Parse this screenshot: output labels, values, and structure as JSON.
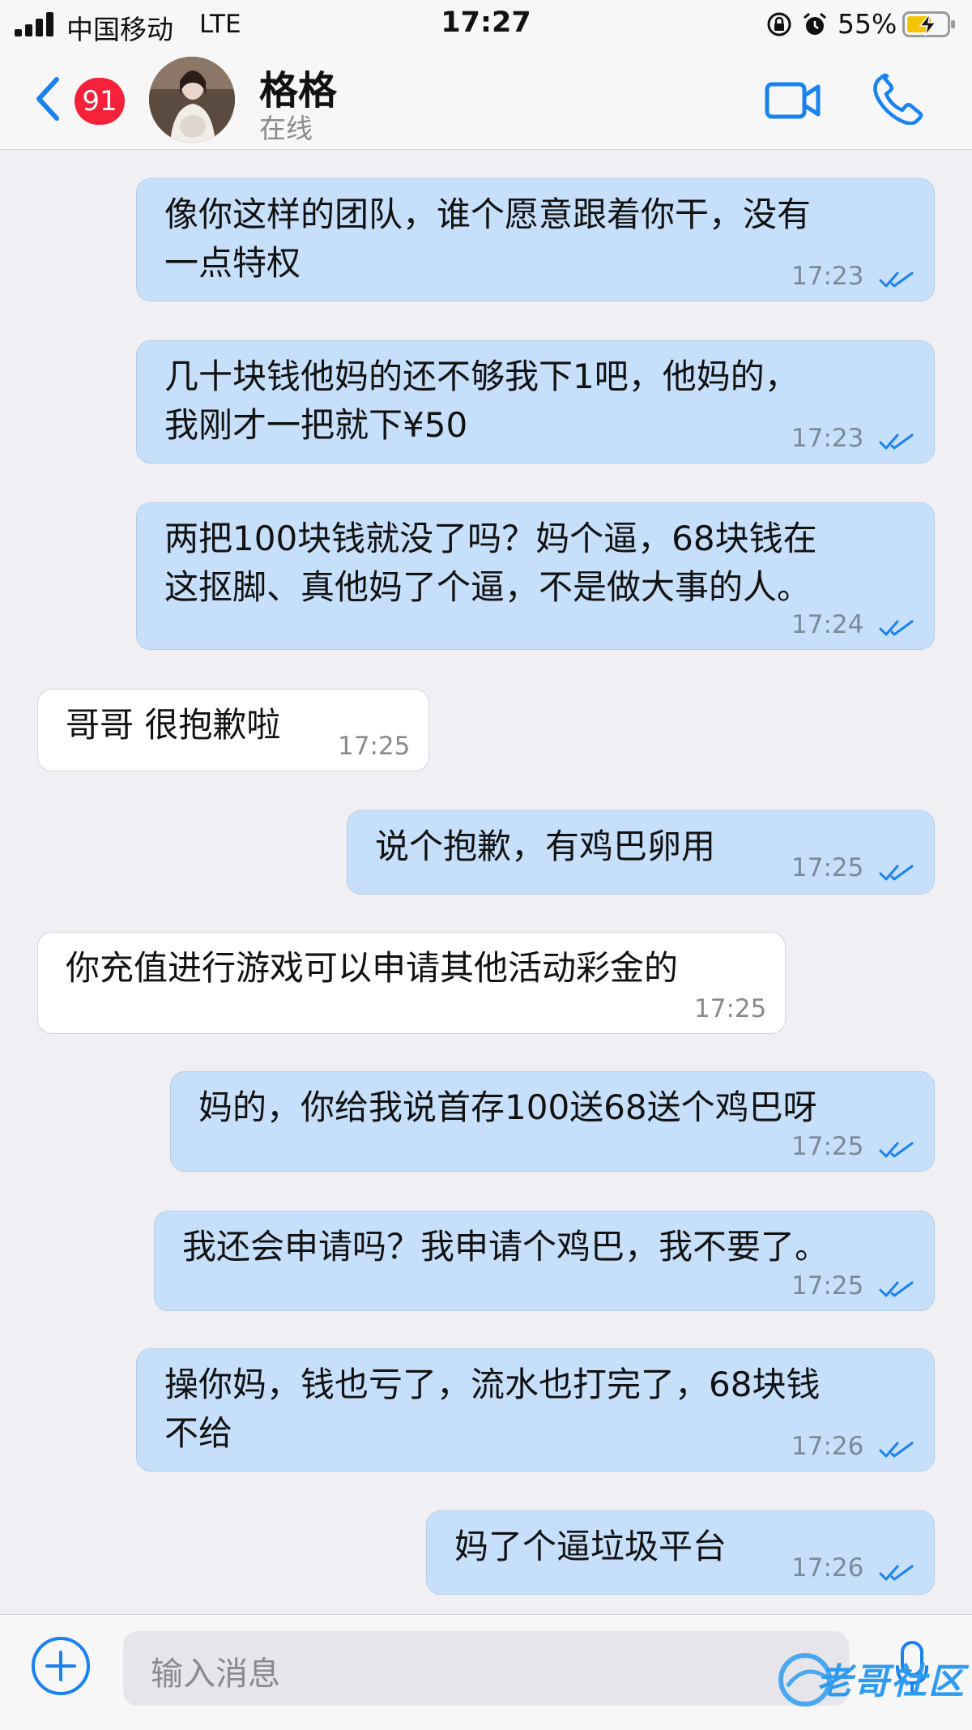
{
  "status_bar": {
    "carrier": "中国移动",
    "network": "LTE",
    "time": "17:27",
    "battery_percent": "55%"
  },
  "header": {
    "unread_badge": "91",
    "contact_name": "格格",
    "presence": "在线"
  },
  "messages": [
    {
      "direction": "out",
      "text": "像你这样的团队，谁个愿意跟着你干，没有\n一点特权",
      "time": "17:23"
    },
    {
      "direction": "out",
      "text": "几十块钱他妈的还不够我下1吧，他妈的，\n我刚才一把就下¥50",
      "time": "17:23"
    },
    {
      "direction": "out",
      "text": "两把100块钱就没了吗？妈个逼，68块钱在\n这抠脚、真他妈了个逼，不是做大事的人。",
      "time": "17:24"
    },
    {
      "direction": "in",
      "text": "哥哥 很抱歉啦",
      "time": "17:25"
    },
    {
      "direction": "out",
      "text": "说个抱歉，有鸡巴卵用",
      "time": "17:25"
    },
    {
      "direction": "in",
      "text": "你充值进行游戏可以申请其他活动彩金的",
      "time": "17:25"
    },
    {
      "direction": "out",
      "text": "妈的，你给我说首存100送68送个鸡巴呀",
      "time": "17:25"
    },
    {
      "direction": "out",
      "text": "我还会申请吗？我申请个鸡巴，我不要了。",
      "time": "17:25"
    },
    {
      "direction": "out",
      "text": "操你妈，钱也亏了，流水也打完了，68块钱\n不给",
      "time": "17:26"
    },
    {
      "direction": "out",
      "text": "妈了个逼垃圾平台",
      "time": "17:26"
    }
  ],
  "input": {
    "placeholder": "输入消息"
  },
  "watermark": {
    "text": "老哥社区"
  },
  "colors": {
    "outgoing_bubble": "#c6e0fb",
    "incoming_bubble": "#ffffff",
    "accent": "#1a82ef",
    "badge": "#f5213b"
  }
}
